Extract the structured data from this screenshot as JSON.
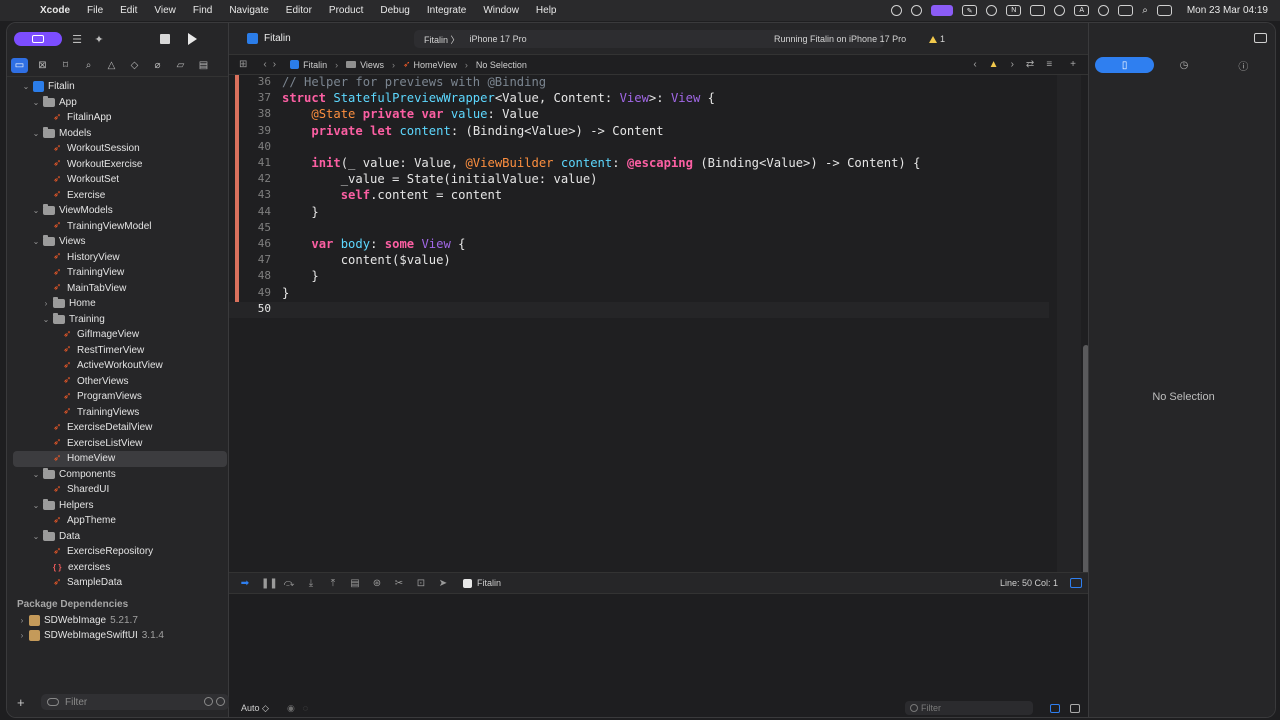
{
  "menubar": {
    "apple": "",
    "items": [
      "Xcode",
      "File",
      "Edit",
      "View",
      "Find",
      "Navigate",
      "Editor",
      "Product",
      "Debug",
      "Integrate",
      "Window",
      "Help"
    ],
    "clock": "Mon 23 Mar 04:19"
  },
  "tree": [
    {
      "label": "Fitalin",
      "kind": "project",
      "depth": 0,
      "open": true
    },
    {
      "label": "App",
      "kind": "folder",
      "depth": 1,
      "open": true
    },
    {
      "label": "FitalinApp",
      "kind": "swift",
      "depth": 2
    },
    {
      "label": "Models",
      "kind": "folder",
      "depth": 1,
      "open": true
    },
    {
      "label": "WorkoutSession",
      "kind": "swift",
      "depth": 2
    },
    {
      "label": "WorkoutExercise",
      "kind": "swift",
      "depth": 2
    },
    {
      "label": "WorkoutSet",
      "kind": "swift",
      "depth": 2
    },
    {
      "label": "Exercise",
      "kind": "swift",
      "depth": 2
    },
    {
      "label": "ViewModels",
      "kind": "folder",
      "depth": 1,
      "open": true
    },
    {
      "label": "TrainingViewModel",
      "kind": "swift",
      "depth": 2
    },
    {
      "label": "Views",
      "kind": "folder",
      "depth": 1,
      "open": true
    },
    {
      "label": "HistoryView",
      "kind": "swift",
      "depth": 2
    },
    {
      "label": "TrainingView",
      "kind": "swift",
      "depth": 2
    },
    {
      "label": "MainTabView",
      "kind": "swift",
      "depth": 2
    },
    {
      "label": "Home",
      "kind": "folder",
      "depth": 2,
      "open": false
    },
    {
      "label": "Training",
      "kind": "folder",
      "depth": 2,
      "open": true
    },
    {
      "label": "GifImageView",
      "kind": "swift",
      "depth": 3
    },
    {
      "label": "RestTimerView",
      "kind": "swift",
      "depth": 3
    },
    {
      "label": "ActiveWorkoutView",
      "kind": "swift",
      "depth": 3
    },
    {
      "label": "OtherViews",
      "kind": "swift",
      "depth": 3
    },
    {
      "label": "ProgramViews",
      "kind": "swift",
      "depth": 3
    },
    {
      "label": "TrainingViews",
      "kind": "swift",
      "depth": 3
    },
    {
      "label": "ExerciseDetailView",
      "kind": "swift",
      "depth": 2
    },
    {
      "label": "ExerciseListView",
      "kind": "swift",
      "depth": 2
    },
    {
      "label": "HomeView",
      "kind": "swift",
      "depth": 2,
      "selected": true
    },
    {
      "label": "Components",
      "kind": "folder",
      "depth": 1,
      "open": true
    },
    {
      "label": "SharedUI",
      "kind": "swift",
      "depth": 2
    },
    {
      "label": "Helpers",
      "kind": "folder",
      "depth": 1,
      "open": true
    },
    {
      "label": "AppTheme",
      "kind": "swift",
      "depth": 2
    },
    {
      "label": "Data",
      "kind": "folder",
      "depth": 1,
      "open": true
    },
    {
      "label": "ExerciseRepository",
      "kind": "swift",
      "depth": 2
    },
    {
      "label": "exercises",
      "kind": "json",
      "depth": 2
    },
    {
      "label": "SampleData",
      "kind": "swift",
      "depth": 2
    }
  ],
  "packages": {
    "title": "Package Dependencies",
    "items": [
      {
        "name": "SDWebImage",
        "version": "5.21.7"
      },
      {
        "name": "SDWebImageSwiftUI",
        "version": "3.1.4"
      }
    ]
  },
  "nav_filter": {
    "placeholder": "Filter"
  },
  "editor": {
    "tab_title": "Fitalin",
    "scheme": "Fitalin",
    "device": "iPhone 17 Pro",
    "status": "Running Fitalin on iPhone 17 Pro",
    "warnings": "1",
    "breadcrumbs": [
      "Fitalin",
      "Views",
      "HomeView",
      "No Selection"
    ]
  },
  "code": [
    {
      "n": "36",
      "tokens": [
        [
          "c",
          "// Helper for previews with @Binding"
        ]
      ]
    },
    {
      "n": "37",
      "tokens": [
        [
          "k",
          "struct"
        ],
        [
          "p",
          " "
        ],
        [
          "d",
          "StatefulPreviewWrapper"
        ],
        [
          "p",
          "<Value, Content: "
        ],
        [
          "t",
          "View"
        ],
        [
          "p",
          ">: "
        ],
        [
          "t",
          "View"
        ],
        [
          "p",
          " {"
        ]
      ]
    },
    {
      "n": "38",
      "tokens": [
        [
          "p",
          "    "
        ],
        [
          "a",
          "@State"
        ],
        [
          "p",
          " "
        ],
        [
          "k",
          "private"
        ],
        [
          "p",
          " "
        ],
        [
          "k",
          "var"
        ],
        [
          "p",
          " "
        ],
        [
          "d",
          "value"
        ],
        [
          "p",
          ": Value"
        ]
      ]
    },
    {
      "n": "39",
      "tokens": [
        [
          "p",
          "    "
        ],
        [
          "k",
          "private"
        ],
        [
          "p",
          " "
        ],
        [
          "k",
          "let"
        ],
        [
          "p",
          " "
        ],
        [
          "d",
          "content"
        ],
        [
          "p",
          ": (Binding<Value>) -> Content"
        ]
      ]
    },
    {
      "n": "40",
      "tokens": []
    },
    {
      "n": "41",
      "tokens": [
        [
          "p",
          "    "
        ],
        [
          "k",
          "init"
        ],
        [
          "p",
          "(_ value: Value, "
        ],
        [
          "o",
          "@ViewBuilder"
        ],
        [
          "p",
          " "
        ],
        [
          "d",
          "content"
        ],
        [
          "p",
          ": "
        ],
        [
          "k",
          "@escaping"
        ],
        [
          "p",
          " (Binding<Value>) -> Content) {"
        ]
      ]
    },
    {
      "n": "42",
      "tokens": [
        [
          "p",
          "        _value = State(initialValue: value)"
        ]
      ]
    },
    {
      "n": "43",
      "tokens": [
        [
          "p",
          "        "
        ],
        [
          "k",
          "self"
        ],
        [
          "p",
          ".content = content"
        ]
      ]
    },
    {
      "n": "44",
      "tokens": [
        [
          "p",
          "    }"
        ]
      ]
    },
    {
      "n": "45",
      "tokens": []
    },
    {
      "n": "46",
      "tokens": [
        [
          "p",
          "    "
        ],
        [
          "k",
          "var"
        ],
        [
          "p",
          " "
        ],
        [
          "d",
          "body"
        ],
        [
          "p",
          ": "
        ],
        [
          "k",
          "some"
        ],
        [
          "p",
          " "
        ],
        [
          "t",
          "View"
        ],
        [
          "p",
          " {"
        ]
      ]
    },
    {
      "n": "47",
      "tokens": [
        [
          "p",
          "        content($value)"
        ]
      ]
    },
    {
      "n": "48",
      "tokens": [
        [
          "p",
          "    }"
        ]
      ]
    },
    {
      "n": "49",
      "tokens": [
        [
          "p",
          "}"
        ]
      ]
    },
    {
      "n": "50",
      "tokens": [],
      "current": true
    }
  ],
  "debug": {
    "target": "Fitalin",
    "position": "Line: 50  Col: 1"
  },
  "console": {
    "mode": "Auto ◇",
    "filter_placeholder": "Filter"
  },
  "inspector": {
    "empty": "No Selection"
  }
}
